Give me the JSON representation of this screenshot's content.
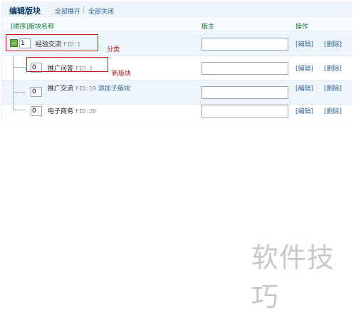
{
  "header_bar": {
    "title": "编辑版块",
    "expand_all": "全部展开",
    "separator": "|",
    "collapse_all": "全部关闭"
  },
  "columns": {
    "order_name": "[顺序]版块名称",
    "moderator": "版主",
    "operations": "操作"
  },
  "rows": [
    {
      "order": "1",
      "name": "经验交流",
      "fid": "FID:1",
      "add_sub": "",
      "moderator": "",
      "edit": "[编辑]",
      "delete": "[删除]",
      "kind": "category"
    },
    {
      "order": "0",
      "name": "推广问答",
      "fid": "FID:2",
      "add_sub": "",
      "moderator": "",
      "edit": "[编辑]",
      "delete": "[删除]",
      "kind": "forum"
    },
    {
      "order": "0",
      "name": "推广交流",
      "fid": "FID:19",
      "add_sub": "添加子版块",
      "moderator": "",
      "edit": "[编辑]",
      "delete": "[删除]",
      "kind": "forum"
    },
    {
      "order": "0",
      "name": "电子商务",
      "fid": "FID:20",
      "add_sub": "",
      "moderator": "",
      "edit": "[编辑]",
      "delete": "[删除]",
      "kind": "forum"
    }
  ],
  "annotations": {
    "category_label": "分类",
    "new_forum_label": "新版块",
    "color": "#c51c1c"
  },
  "icons": {
    "category": "category-collapse-icon"
  },
  "watermark": "软件技巧"
}
